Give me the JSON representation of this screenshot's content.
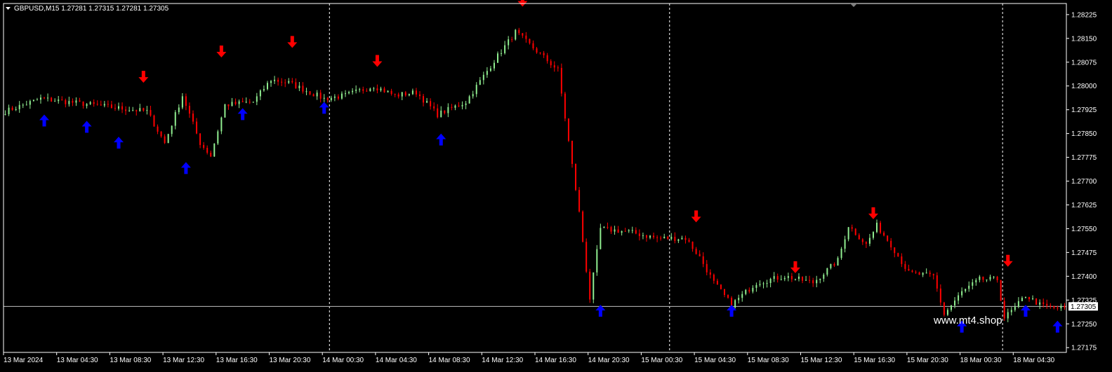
{
  "chart_data": {
    "type": "candlestick",
    "symbol_line": "GBPUSD,M15  1.27281 1.27315 1.27281 1.27305",
    "current_price": 1.27305,
    "current_price_label": "1.27305",
    "watermark": "www.mt4.shop",
    "ylim": [
      1.2716,
      1.2826
    ],
    "y_ticks": [
      "1.28225",
      "1.28150",
      "1.28075",
      "1.28000",
      "1.27925",
      "1.27850",
      "1.27775",
      "1.27700",
      "1.27625",
      "1.27550",
      "1.27475",
      "1.27400",
      "1.27325",
      "1.27250",
      "1.27175"
    ],
    "x_ticks": [
      "13 Mar 2024",
      "13 Mar 04:30",
      "13 Mar 08:30",
      "13 Mar 12:30",
      "13 Mar 16:30",
      "13 Mar 20:30",
      "14 Mar 00:30",
      "14 Mar 04:30",
      "14 Mar 08:30",
      "14 Mar 12:30",
      "14 Mar 16:30",
      "14 Mar 20:30",
      "15 Mar 00:30",
      "15 Mar 04:30",
      "15 Mar 08:30",
      "15 Mar 12:30",
      "15 Mar 16:30",
      "15 Mar 20:30",
      "18 Mar 00:30",
      "18 Mar 04:30"
    ],
    "bar_count": 300,
    "day_separators_after_bar": [
      92,
      188,
      282
    ],
    "price_path": [
      [
        0,
        1.2792
      ],
      [
        10,
        1.2796
      ],
      [
        25,
        1.2794
      ],
      [
        32,
        1.2793
      ],
      [
        40,
        1.2792
      ],
      [
        45,
        1.2782
      ],
      [
        50,
        1.2797
      ],
      [
        55,
        1.2782
      ],
      [
        58,
        1.2778
      ],
      [
        62,
        1.2794
      ],
      [
        70,
        1.2795
      ],
      [
        75,
        1.2802
      ],
      [
        80,
        1.2801
      ],
      [
        90,
        1.2796
      ],
      [
        96,
        1.2797
      ],
      [
        104,
        1.28
      ],
      [
        110,
        1.2797
      ],
      [
        116,
        1.2798
      ],
      [
        122,
        1.2791
      ],
      [
        130,
        1.2795
      ],
      [
        138,
        1.2808
      ],
      [
        144,
        1.2817
      ],
      [
        147,
        1.2814
      ],
      [
        152,
        1.2809
      ],
      [
        156,
        1.2805
      ],
      [
        162,
        1.276
      ],
      [
        165,
        1.2733
      ],
      [
        168,
        1.2755
      ],
      [
        176,
        1.2754
      ],
      [
        184,
        1.2752
      ],
      [
        192,
        1.2752
      ],
      [
        196,
        1.2746
      ],
      [
        200,
        1.2738
      ],
      [
        205,
        1.2731
      ],
      [
        212,
        1.2738
      ],
      [
        220,
        1.274
      ],
      [
        228,
        1.2738
      ],
      [
        235,
        1.2745
      ],
      [
        238,
        1.2756
      ],
      [
        243,
        1.275
      ],
      [
        246,
        1.2756
      ],
      [
        250,
        1.275
      ],
      [
        255,
        1.2741
      ],
      [
        262,
        1.274
      ],
      [
        265,
        1.2728
      ],
      [
        270,
        1.2735
      ],
      [
        275,
        1.2739
      ],
      [
        280,
        1.2739
      ],
      [
        282,
        1.2727
      ],
      [
        285,
        1.273
      ],
      [
        288,
        1.2734
      ],
      [
        292,
        1.2731
      ],
      [
        296,
        1.273
      ],
      [
        300,
        1.273
      ]
    ],
    "signals": [
      {
        "dir": "up",
        "bar": 11,
        "price": 1.2791
      },
      {
        "dir": "up",
        "bar": 23,
        "price": 1.2789
      },
      {
        "dir": "up",
        "bar": 32,
        "price": 1.2784
      },
      {
        "dir": "down",
        "bar": 39,
        "price": 1.2801
      },
      {
        "dir": "up",
        "bar": 51,
        "price": 1.2776
      },
      {
        "dir": "down",
        "bar": 61,
        "price": 1.2809
      },
      {
        "dir": "up",
        "bar": 67,
        "price": 1.2793
      },
      {
        "dir": "down",
        "bar": 81,
        "price": 1.2812
      },
      {
        "dir": "up",
        "bar": 90,
        "price": 1.2795
      },
      {
        "dir": "down",
        "bar": 105,
        "price": 1.2806
      },
      {
        "dir": "up",
        "bar": 123,
        "price": 1.2785
      },
      {
        "dir": "down",
        "bar": 146,
        "price": 1.2825
      },
      {
        "dir": "up",
        "bar": 168,
        "price": 1.2731
      },
      {
        "dir": "down",
        "bar": 195,
        "price": 1.2757
      },
      {
        "dir": "up",
        "bar": 205,
        "price": 1.2731
      },
      {
        "dir": "down",
        "bar": 223,
        "price": 1.2741
      },
      {
        "dir": "down",
        "bar": 245,
        "price": 1.2758
      },
      {
        "dir": "up",
        "bar": 270,
        "price": 1.2726
      },
      {
        "dir": "down",
        "bar": 283,
        "price": 1.2743
      },
      {
        "dir": "up",
        "bar": 288,
        "price": 1.2731
      },
      {
        "dir": "up",
        "bar": 297,
        "price": 1.2726
      }
    ],
    "colors": {
      "background": "#000000",
      "frame": "#ffffff",
      "bull": "#90ee90",
      "bear": "#ff0000",
      "buy_arrow": "#0000ff",
      "sell_arrow": "#ff0000",
      "separator": "#ffffff",
      "price_line": "#c0c0c0",
      "price_box": "#ffffff"
    }
  }
}
